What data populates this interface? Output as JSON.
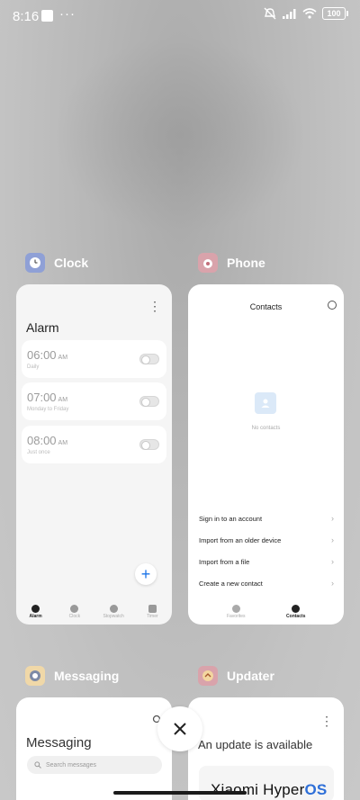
{
  "status_bar": {
    "time": "8:16",
    "dots": "···",
    "battery": "100"
  },
  "apps": {
    "clock": {
      "label": "Clock",
      "screen_title": "Alarm",
      "alarms": [
        {
          "time": "06:00",
          "ampm": "AM",
          "sub": "Daily"
        },
        {
          "time": "07:00",
          "ampm": "AM",
          "sub": "Monday to Friday"
        },
        {
          "time": "08:00",
          "ampm": "AM",
          "sub": "Just once"
        }
      ],
      "nav": [
        "Alarm",
        "Clock",
        "Stopwatch",
        "Timer"
      ]
    },
    "phone": {
      "label": "Phone",
      "screen_title": "Contacts",
      "empty_text": "No contacts",
      "menu": [
        "Sign in to an account",
        "Import from an older device",
        "Import from a file",
        "Create a new contact"
      ],
      "nav": [
        "Favorites",
        "Contacts"
      ]
    },
    "messaging": {
      "label": "Messaging",
      "screen_title": "Messaging",
      "search_placeholder": "Search messages"
    },
    "updater": {
      "label": "Updater",
      "screen_title": "An update is available"
    }
  },
  "branding": {
    "text": "Xiaomi Hyper",
    "accent": "OS"
  },
  "colors": {
    "accent_blue": "#1a73e8",
    "hyperos_blue": "#2e6fd8"
  }
}
